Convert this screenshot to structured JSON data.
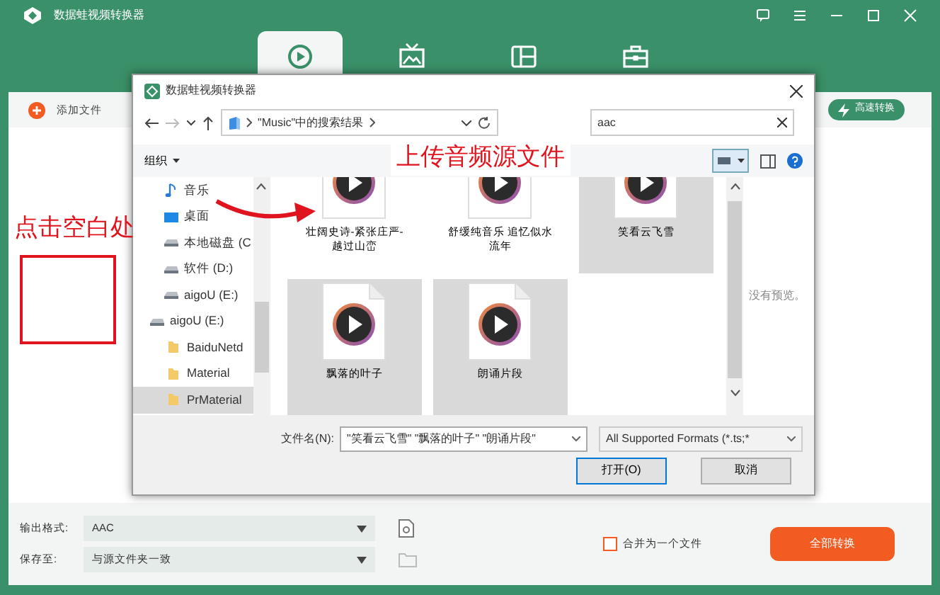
{
  "app": {
    "title": "数据蛙视频转换器"
  },
  "main_tabs": [
    {
      "kind": "convert",
      "selected": true
    },
    {
      "kind": "tv",
      "selected": false
    },
    {
      "kind": "layout",
      "selected": false
    },
    {
      "kind": "toolbox",
      "selected": false
    }
  ],
  "toolbar": {
    "add_files": "添加文件",
    "fast_convert": "高速转换"
  },
  "dialog": {
    "title": "数据蛙视频转换器",
    "address": "\"Music\"中的搜索结果",
    "search": {
      "value": "aac"
    },
    "organize": "组织",
    "nav": [
      {
        "kind": "music",
        "label": "音乐",
        "selected": false
      },
      {
        "kind": "desktop",
        "label": "桌面",
        "selected": false
      },
      {
        "kind": "drive",
        "label": "本地磁盘 (C",
        "selected": false
      },
      {
        "kind": "drive",
        "label": "软件 (D:)",
        "selected": false
      },
      {
        "kind": "drive",
        "label": "aigoU (E:)",
        "selected": false
      },
      {
        "kind": "drive",
        "label": "aigoU (E:)",
        "selected": false,
        "children": [
          {
            "kind": "folder",
            "label": "BaiduNetd",
            "selected": false
          },
          {
            "kind": "folder",
            "label": "Material",
            "selected": false
          },
          {
            "kind": "folder",
            "label": "PrMaterial",
            "selected": true
          }
        ]
      }
    ],
    "files": [
      {
        "name": "壮阔史诗-紧张庄严-越过山峦",
        "selected": false
      },
      {
        "name": "舒缓纯音乐 追忆似水流年",
        "selected": false
      },
      {
        "name": "笑看云飞雪",
        "selected": true
      },
      {
        "name": "飘落的叶子",
        "selected": true
      },
      {
        "name": "朗诵片段",
        "selected": true
      }
    ],
    "preview_text": "没有预览。",
    "filename_label": "文件名(N):",
    "filename_value": "\"笑看云飞雪\" \"飘落的叶子\" \"朗诵片段\"",
    "file_type": "All Supported Formats (*.ts;*",
    "open": "打开(O)",
    "cancel": "取消"
  },
  "annotations": {
    "click_hint": "点击空白处",
    "upload_hint": "上传音频源文件"
  },
  "bottom": {
    "output_format_label": "输出格式:",
    "output_format": "AAC",
    "save_to_label": "保存至:",
    "save_to": "与源文件夹一致",
    "merge": {
      "label": "合并为一个文件",
      "checked": false
    },
    "convert_all": "全部转换"
  }
}
